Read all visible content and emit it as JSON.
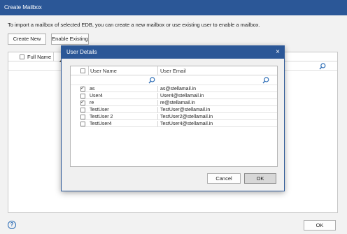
{
  "window": {
    "title": "Create Mailbox",
    "intro_text": "To import a mailbox of selected EDB, you can create a new mailbox or use existing user to enable a mailbox.",
    "create_new_label": "Create New",
    "enable_existing_label": "Enable Existing",
    "grid_header_full_name": "Full Name",
    "ok_label": "OK",
    "help_symbol": "?"
  },
  "dialog": {
    "title": "User Details",
    "close_symbol": "×",
    "columns": {
      "user_name": "User Name",
      "user_email": "User Email"
    },
    "rows": [
      {
        "name": "as",
        "email": "as@stellamail.in",
        "checked": true
      },
      {
        "name": "User4",
        "email": "User4@stellamail.in",
        "checked": false
      },
      {
        "name": "re",
        "email": "re@stellamail.in",
        "checked": true
      },
      {
        "name": "TestUser",
        "email": "TestUser@stellamail.in",
        "checked": false
      },
      {
        "name": "TestUser 2",
        "email": "TestUser2@stellamail.in",
        "checked": false
      },
      {
        "name": "TestUser4",
        "email": "TestUser4@stellamail.in",
        "checked": false
      }
    ],
    "cancel_label": "Cancel",
    "ok_label": "OK"
  },
  "colors": {
    "titlebar": "#2b5797",
    "background": "#f2f2f2"
  }
}
